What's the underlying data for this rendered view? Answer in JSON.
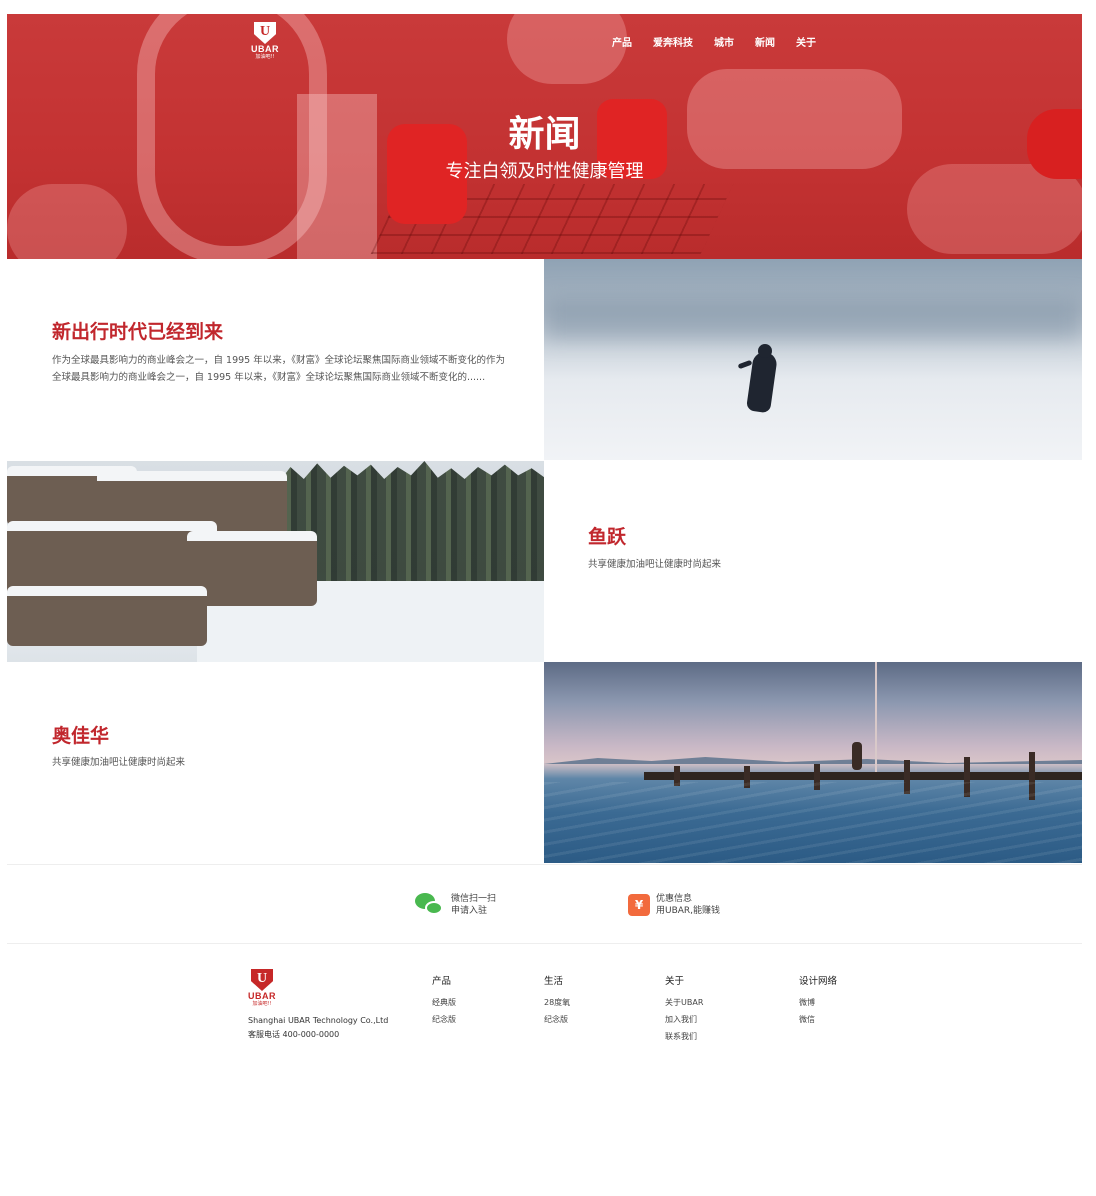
{
  "brand": {
    "mark": "U",
    "name": "UBAR",
    "tagline": "加油吧!!"
  },
  "nav": {
    "items": [
      "产品",
      "爱奔科技",
      "城市",
      "新闻",
      "关于"
    ]
  },
  "hero": {
    "title": "新闻",
    "subtitle": "专注白领及时性健康管理"
  },
  "news": [
    {
      "title": "新出行时代已经到来",
      "body": "作为全球最具影响力的商业峰会之一，自 1995 年以来，《财富》全球论坛聚焦国际商业领域不断变化的作为全球最具影响力的商业峰会之一，自 1995 年以来，《财富》全球论坛聚焦国际商业领域不断变化的......"
    },
    {
      "title": "鱼跃",
      "body": "共享健康加油吧让健康时尚起来"
    },
    {
      "title": "奥佳华",
      "body": "共享健康加油吧让健康时尚起来"
    }
  ],
  "qr": {
    "wechat": {
      "line1": "微信扫一扫",
      "line2": "申请入驻"
    },
    "deals": {
      "line1": "优惠信息",
      "line2": "用UBAR,能赚钱"
    }
  },
  "footer": {
    "company": "Shanghai UBAR Technology Co.,Ltd",
    "phone": "客服电话 400-000-0000",
    "columns": [
      {
        "heading": "产品",
        "links": [
          "经典版",
          "纪念版"
        ]
      },
      {
        "heading": "生活",
        "links": [
          "28度氧",
          "纪念版"
        ]
      },
      {
        "heading": "关于",
        "links": [
          "关于UBAR",
          "加入我们",
          "联系我们"
        ]
      },
      {
        "heading": "设计网络",
        "links": [
          "微博",
          "微信"
        ]
      }
    ]
  },
  "colors": {
    "brand_red": "#c62828",
    "title_red": "#c1272d",
    "wechat_green": "#49b84f",
    "deal_orange": "#f26a3d"
  }
}
